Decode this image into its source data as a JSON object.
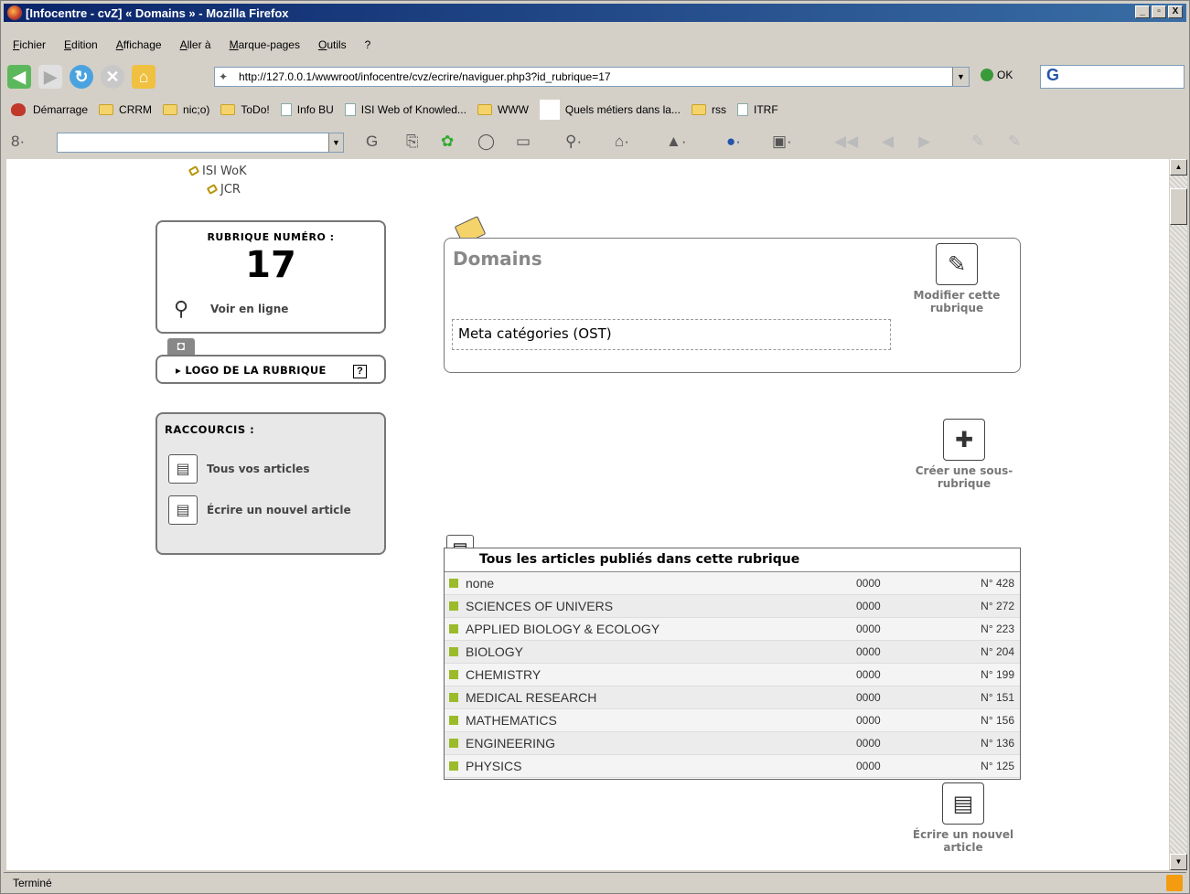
{
  "window": {
    "title": "[Infocentre - cvZ] « Domains » - Mozilla Firefox",
    "buttons": [
      "_",
      "▫",
      "X"
    ]
  },
  "menu": [
    "Fichier",
    "Edition",
    "Affichage",
    "Aller à",
    "Marque-pages",
    "Outils",
    "?"
  ],
  "nav": {
    "url": "http://127.0.0.1/wwwroot/infocentre/cvz/ecrire/naviguer.php3?id_rubrique=17",
    "ok_label": "OK",
    "search_logo": "G"
  },
  "bookmarks": [
    {
      "label": "Démarrage",
      "icon": "red-icon"
    },
    {
      "label": "CRRM",
      "icon": "folder"
    },
    {
      "label": "nic;o)",
      "icon": "folder"
    },
    {
      "label": "ToDo!",
      "icon": "folder"
    },
    {
      "label": "Info BU",
      "icon": "page"
    },
    {
      "label": "ISI Web of Knowled...",
      "icon": "page"
    },
    {
      "label": "WWW",
      "icon": "folder"
    },
    {
      "label": "Quels métiers dans la...",
      "icon": "blank"
    },
    {
      "label": "rss",
      "icon": "folder"
    },
    {
      "label": "ITRF",
      "icon": "page"
    }
  ],
  "tree": {
    "item1": "ISI WoK",
    "item2": "JCR"
  },
  "rubrique": {
    "label": "RUBRIQUE NUMÉRO :",
    "number": "17",
    "voir": "Voir en ligne"
  },
  "logo": {
    "label": "▸ LOGO DE LA RUBRIQUE",
    "help": "?"
  },
  "raccourcis": {
    "title": "RACCOURCIS :",
    "all": "Tous vos articles",
    "new": "Écrire un nouvel article"
  },
  "domain": {
    "title": "Domains",
    "meta": "Meta catégories (OST)"
  },
  "actions": {
    "modify": "Modifier cette rubrique",
    "create": "Créer une sous-rubrique",
    "write": "Écrire un nouvel article"
  },
  "articles": {
    "heading": "Tous les articles publiés dans cette rubrique",
    "rows": [
      {
        "name": "none",
        "date": "0000",
        "num": "N° 428"
      },
      {
        "name": "SCIENCES OF UNIVERS",
        "date": "0000",
        "num": "N° 272"
      },
      {
        "name": "APPLIED BIOLOGY & ECOLOGY",
        "date": "0000",
        "num": "N° 223"
      },
      {
        "name": "BIOLOGY",
        "date": "0000",
        "num": "N° 204"
      },
      {
        "name": "CHEMISTRY",
        "date": "0000",
        "num": "N° 199"
      },
      {
        "name": "MEDICAL RESEARCH",
        "date": "0000",
        "num": "N° 151"
      },
      {
        "name": "MATHEMATICS",
        "date": "0000",
        "num": "N° 156"
      },
      {
        "name": "ENGINEERING",
        "date": "0000",
        "num": "N° 136"
      },
      {
        "name": "PHYSICS",
        "date": "0000",
        "num": "N° 125"
      }
    ]
  },
  "status": "Terminé"
}
